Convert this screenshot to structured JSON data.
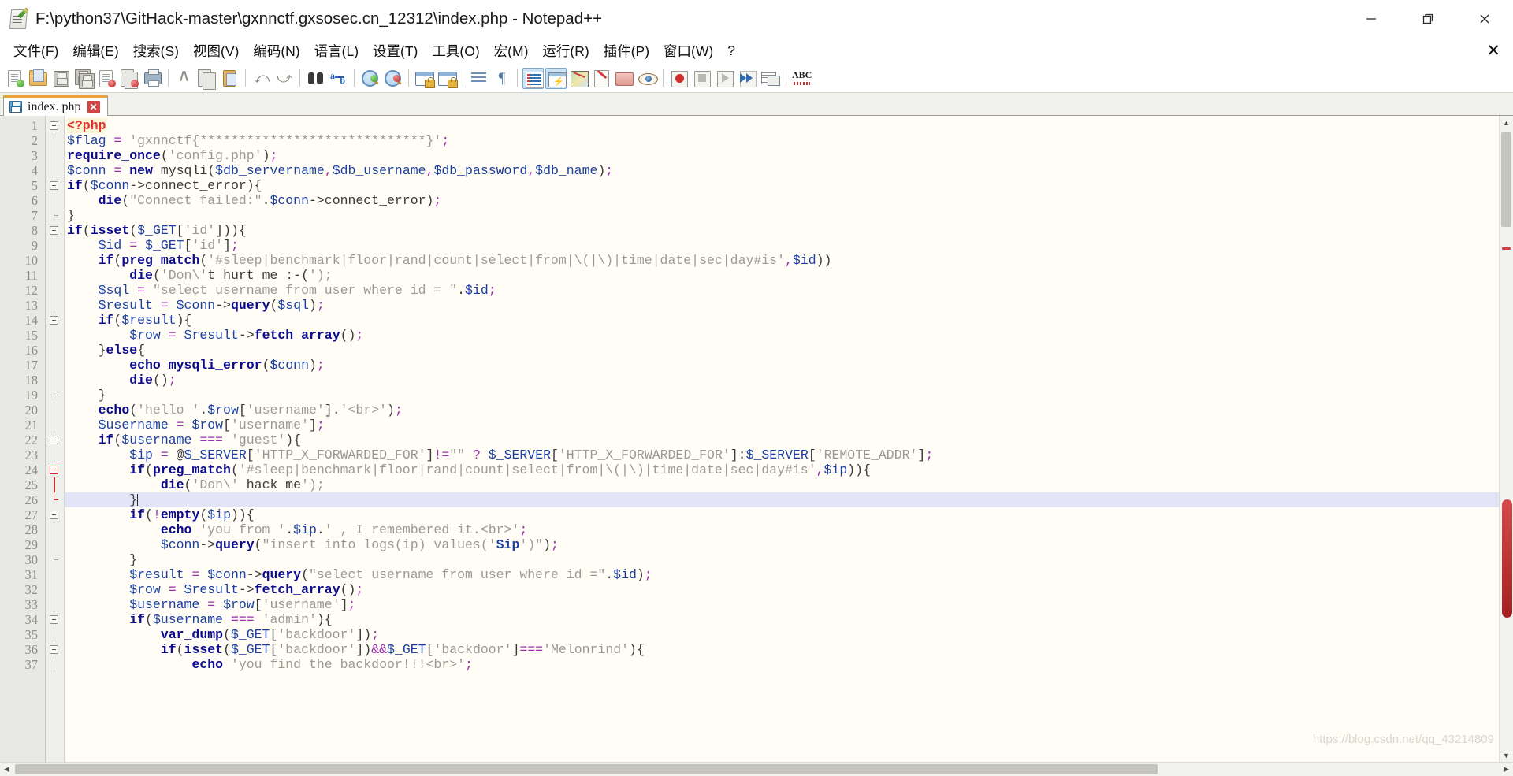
{
  "window": {
    "title": "F:\\python37\\GitHack-master\\gxnnctf.gxsosec.cn_12312\\index.php - Notepad++",
    "icon": "notepad-plus-plus-icon",
    "minimize_label": "─",
    "restore_label": "❐",
    "close_label": "✕"
  },
  "menubar": {
    "items": [
      {
        "label": "文件(F)",
        "name": "menu-file"
      },
      {
        "label": "编辑(E)",
        "name": "menu-edit"
      },
      {
        "label": "搜索(S)",
        "name": "menu-search"
      },
      {
        "label": "视图(V)",
        "name": "menu-view"
      },
      {
        "label": "编码(N)",
        "name": "menu-encoding"
      },
      {
        "label": "语言(L)",
        "name": "menu-language"
      },
      {
        "label": "设置(T)",
        "name": "menu-settings"
      },
      {
        "label": "工具(O)",
        "name": "menu-tools"
      },
      {
        "label": "宏(M)",
        "name": "menu-macro"
      },
      {
        "label": "运行(R)",
        "name": "menu-run"
      },
      {
        "label": "插件(P)",
        "name": "menu-plugins"
      },
      {
        "label": "窗口(W)",
        "name": "menu-window"
      },
      {
        "label": "?",
        "name": "menu-help"
      }
    ],
    "close_document_label": "✕"
  },
  "toolbar": {
    "buttons": [
      "new-file-icon",
      "open-file-icon",
      "save-icon",
      "save-all-icon",
      "close-file-icon",
      "close-all-files-icon",
      "print-icon",
      "cut-icon",
      "copy-icon",
      "paste-icon",
      "undo-icon",
      "redo-icon",
      "find-icon",
      "replace-icon",
      "zoom-in-icon",
      "zoom-out-icon",
      "sync-vertical-scroll-icon",
      "sync-horizontal-scroll-icon",
      "word-wrap-icon",
      "show-all-characters-icon",
      "indent-guide-icon",
      "user-defined-language-icon",
      "document-map-icon",
      "function-list-icon",
      "folder-as-workspace-icon",
      "monitoring-icon",
      "record-macro-icon",
      "stop-record-icon",
      "play-macro-icon",
      "run-macro-multiple-icon",
      "save-macro-icon",
      "spell-check-icon"
    ]
  },
  "tabbar": {
    "tabs": [
      {
        "label": "index. php",
        "icon": "saved-file-icon",
        "close_label": "✕",
        "active": true
      }
    ]
  },
  "editor": {
    "current_line": 26,
    "first_line": 1,
    "last_line": 37,
    "lines": [
      {
        "n": 1,
        "fold": "open",
        "text": "<?php"
      },
      {
        "n": 2,
        "fold": "bar",
        "text": "$flag = 'gxnnctf{*****************************}';"
      },
      {
        "n": 3,
        "fold": "bar",
        "text": "require_once('config.php');"
      },
      {
        "n": 4,
        "fold": "bar",
        "text": "$conn = new mysqli($db_servername,$db_username,$db_password,$db_name);"
      },
      {
        "n": 5,
        "fold": "open",
        "text": "if($conn->connect_error){"
      },
      {
        "n": 6,
        "fold": "bar",
        "text": "    die(\"Connect failed:\".$conn->connect_error);"
      },
      {
        "n": 7,
        "fold": "end",
        "text": "}"
      },
      {
        "n": 8,
        "fold": "open",
        "text": "if(isset($_GET['id'])){"
      },
      {
        "n": 9,
        "fold": "bar",
        "text": "    $id = $_GET['id'];"
      },
      {
        "n": 10,
        "fold": "bar",
        "text": "    if(preg_match('#sleep|benchmark|floor|rand|count|select|from|\\(|\\)|time|date|sec|day#is',$id))"
      },
      {
        "n": 11,
        "fold": "bar",
        "text": "        die('Don\\'t hurt me :-(');"
      },
      {
        "n": 12,
        "fold": "bar",
        "text": "    $sql = \"select username from user where id = \".$id;"
      },
      {
        "n": 13,
        "fold": "bar",
        "text": "    $result = $conn->query($sql);"
      },
      {
        "n": 14,
        "fold": "open",
        "text": "    if($result){"
      },
      {
        "n": 15,
        "fold": "bar",
        "text": "        $row = $result->fetch_array();"
      },
      {
        "n": 16,
        "fold": "bar",
        "text": "    }else{"
      },
      {
        "n": 17,
        "fold": "bar",
        "text": "        echo mysqli_error($conn);"
      },
      {
        "n": 18,
        "fold": "bar",
        "text": "        die();"
      },
      {
        "n": 19,
        "fold": "end",
        "text": "    }"
      },
      {
        "n": 20,
        "fold": "bar",
        "text": "    echo('hello '.$row['username'].'<br>');"
      },
      {
        "n": 21,
        "fold": "bar",
        "text": "    $username = $row['username'];"
      },
      {
        "n": 22,
        "fold": "open",
        "text": "    if($username === 'guest'){"
      },
      {
        "n": 23,
        "fold": "bar",
        "text": "        $ip = @$_SERVER['HTTP_X_FORWARDED_FOR']!=\"\" ? $_SERVER['HTTP_X_FORWARDED_FOR']:$_SERVER['REMOTE_ADDR'];"
      },
      {
        "n": 24,
        "fold": "openred",
        "text": "        if(preg_match('#sleep|benchmark|floor|rand|count|select|from|\\(|\\)|time|date|sec|day#is',$ip)){"
      },
      {
        "n": 25,
        "fold": "barred",
        "text": "            die('Don\\' hack me');"
      },
      {
        "n": 26,
        "fold": "endred",
        "text": "        }"
      },
      {
        "n": 27,
        "fold": "open",
        "text": "        if(!empty($ip)){"
      },
      {
        "n": 28,
        "fold": "bar",
        "text": "            echo 'you from '.$ip.' , I remembered it.<br>';"
      },
      {
        "n": 29,
        "fold": "bar",
        "text": "            $conn->query(\"insert into logs(ip) values('$ip')\");"
      },
      {
        "n": 30,
        "fold": "end",
        "text": "        }"
      },
      {
        "n": 31,
        "fold": "bar",
        "text": "        $result = $conn->query(\"select username from user where id =\".$id);"
      },
      {
        "n": 32,
        "fold": "bar",
        "text": "        $row = $result->fetch_array();"
      },
      {
        "n": 33,
        "fold": "bar",
        "text": "        $username = $row['username'];"
      },
      {
        "n": 34,
        "fold": "open",
        "text": "        if($username === 'admin'){"
      },
      {
        "n": 35,
        "fold": "bar",
        "text": "            var_dump($_GET['backdoor']);"
      },
      {
        "n": 36,
        "fold": "open",
        "text": "            if(isset($_GET['backdoor'])&&$_GET['backdoor']==='Melonrind'){"
      },
      {
        "n": 37,
        "fold": "bar",
        "text": "                echo 'you find the backdoor!!!<br>';"
      }
    ]
  },
  "scrollbars": {
    "vertical_up_label": "▲",
    "vertical_down_label": "▼",
    "horizontal_left_label": "◀",
    "horizontal_right_label": "▶"
  },
  "watermark": {
    "text": "https://blog.csdn.net/qq_43214809"
  },
  "colors": {
    "keyword": "#0b0b8f",
    "variable": "#1b3fa0",
    "string": "#9a9a93",
    "operator": "#9b2fae",
    "php_tag": "#e03030",
    "current_line_bg": "#e4e4f7",
    "editor_bg": "#fffdf5",
    "tab_accent": "#e8a33d",
    "fold_active": "#cc2b2b"
  }
}
